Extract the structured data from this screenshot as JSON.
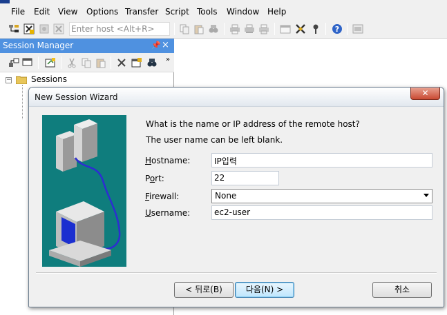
{
  "menu": [
    "File",
    "Edit",
    "View",
    "Options",
    "Transfer",
    "Script",
    "Tools",
    "Window",
    "Help"
  ],
  "toolbar": {
    "quick_connect_placeholder": "Enter host <Alt+R>",
    "icons": [
      "connect-icon",
      "quick-connect-icon",
      "connect-in-tab-icon",
      "disconnect-icon",
      "copy-icon",
      "paste-icon",
      "find-icon",
      "print-icon",
      "print-setup-icon",
      "print-screen-icon",
      "session-options-icon",
      "global-options-icon",
      "keymap-icon",
      "help-icon",
      "sftp-icon"
    ]
  },
  "session_manager": {
    "title": "Session Manager",
    "pin_glyph": "ᵖ",
    "close_glyph": "×",
    "tree": {
      "expander": "−",
      "root_label": "Sessions"
    }
  },
  "dialog": {
    "title": "New Session Wizard",
    "close_glyph": "✕",
    "prompt_line1": "What is the name or IP address of the remote host?",
    "prompt_line2": "The user name can be left blank.",
    "fields": {
      "hostname": {
        "label_key": "H",
        "label_rest": "ostname:",
        "value": "IP입력"
      },
      "port": {
        "label_pre": "P",
        "label_key": "o",
        "label_rest": "rt:",
        "value": "22"
      },
      "firewall": {
        "label_key": "F",
        "label_rest": "irewall:",
        "value": "None"
      },
      "username": {
        "label_key": "U",
        "label_rest": "sername:",
        "value": "ec2-user"
      }
    },
    "buttons": {
      "back": "< 뒤로(B)",
      "next": "다음(N) >",
      "cancel": "취소"
    }
  },
  "colors": {
    "session_title_bg": "#4f91e0",
    "wizard_image_bg": "#0f7d7d",
    "close_button": "#c94a33"
  }
}
